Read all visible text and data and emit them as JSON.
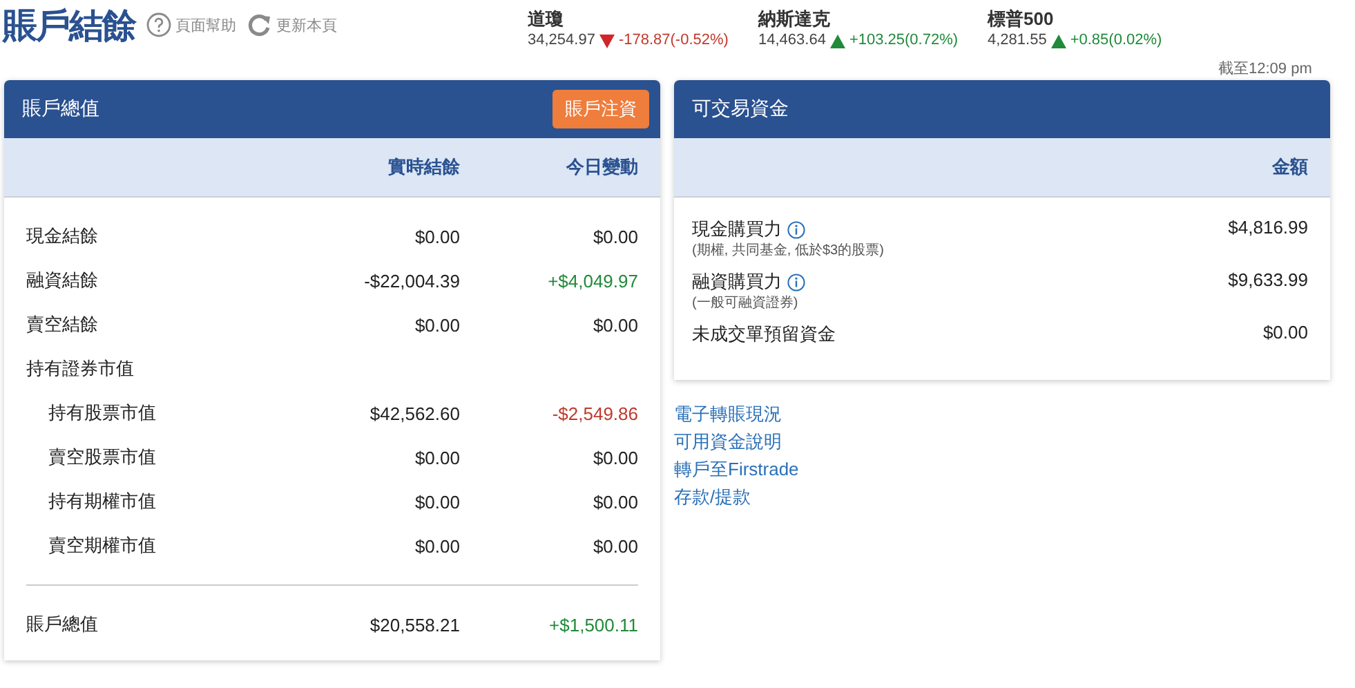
{
  "page": {
    "title": "賬戶結餘",
    "help": "頁面幫助",
    "refresh": "更新本頁"
  },
  "indices": [
    {
      "name": "道瓊",
      "value": "34,254.97",
      "falling": true,
      "change": "-178.87(-0.52%)",
      "color": "#c0392b"
    },
    {
      "name": "納斯達克",
      "value": "14,463.64",
      "falling": false,
      "change": "+103.25(0.72%)",
      "color": "#208a3a"
    },
    {
      "name": "標普500",
      "value": "4,281.55",
      "falling": false,
      "change": "+0.85(0.02%)",
      "color": "#208a3a"
    }
  ],
  "as_of": "截至12:09 pm",
  "account_value": {
    "title": "賬戶總值",
    "button": "賬戶注資",
    "columns": [
      "實時結餘",
      "今日變動"
    ],
    "rows": [
      {
        "label": "現金結餘",
        "balance": "$0.00",
        "change": "$0.00",
        "color": "#222222"
      },
      {
        "label": "融資結餘",
        "balance": "-$22,004.39",
        "change": "+$4,049.97",
        "color": "#208a3a"
      },
      {
        "label": "賣空結餘",
        "balance": "$0.00",
        "change": "$0.00",
        "color": "#222222"
      },
      {
        "label": "持有證券市值",
        "children": [
          {
            "label": "持有股票市值",
            "balance": "$42,562.60",
            "change": "-$2,549.86",
            "color": "#c0392b"
          },
          {
            "label": "賣空股票市值",
            "balance": "$0.00",
            "change": "$0.00",
            "color": "#222222"
          },
          {
            "label": "持有期權市值",
            "balance": "$0.00",
            "change": "$0.00",
            "color": "#222222"
          },
          {
            "label": "賣空期權市值",
            "balance": "$0.00",
            "change": "$0.00",
            "color": "#222222"
          }
        ]
      }
    ],
    "total": {
      "label": "賬戶總值",
      "balance": "$20,558.21",
      "change": "+$1,500.11",
      "color": "#208a3a"
    }
  },
  "tradable_funds": {
    "title": "可交易資金",
    "column": "金額",
    "rows": [
      {
        "label": "現金購買力",
        "info": true,
        "note": "(期權, 共同基金, 低於$3的股票)",
        "amount": "$4,816.99"
      },
      {
        "label": "融資購買力",
        "info": true,
        "note": "(一般可融資證券)",
        "amount": "$9,633.99"
      },
      {
        "label": "未成交單預留資金",
        "info": false,
        "amount": "$0.00"
      }
    ]
  },
  "links": [
    "電子轉賬現況",
    "可用資金說明",
    "轉戶至Firstrade",
    "存款/提款"
  ]
}
